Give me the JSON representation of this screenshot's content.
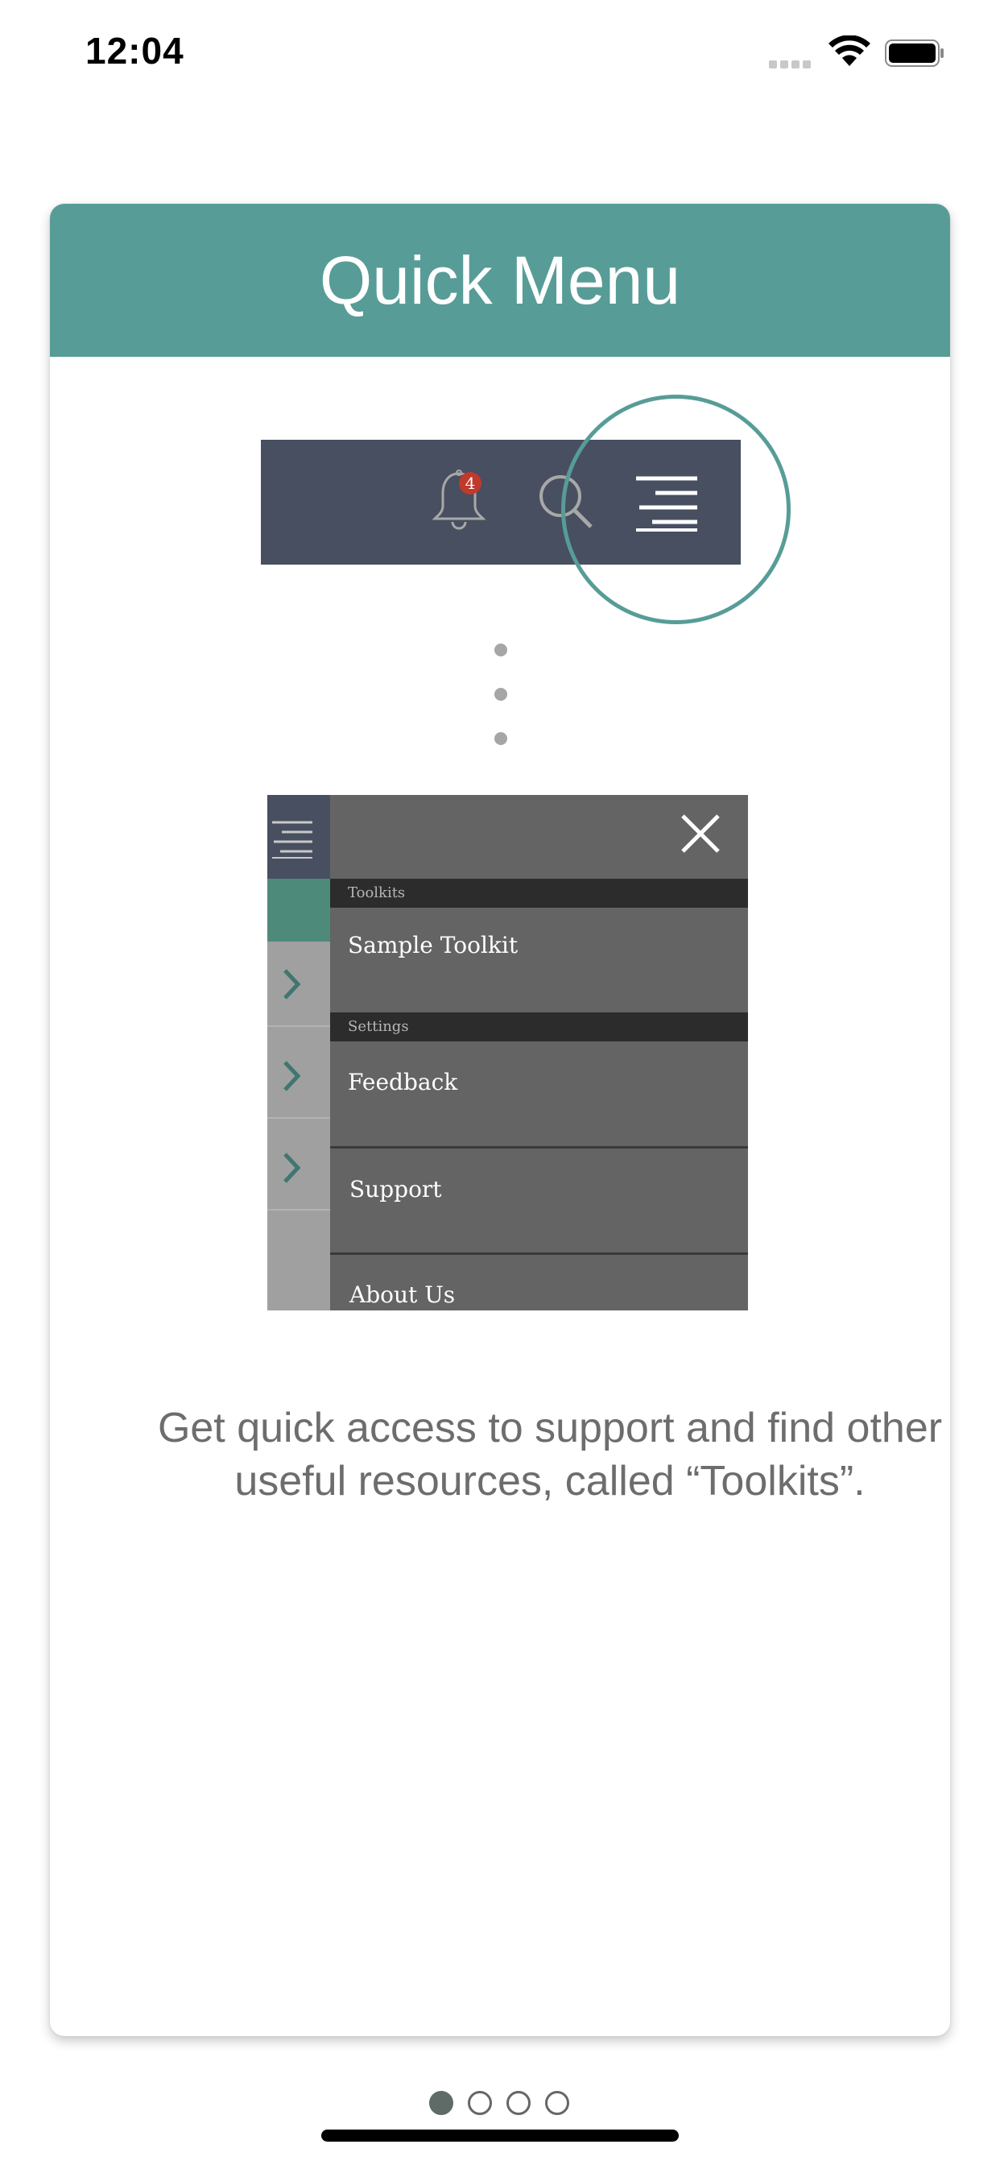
{
  "status_bar": {
    "time": "12:04"
  },
  "card": {
    "title": "Quick Menu",
    "accent_color": "#579c97",
    "illustration_top": {
      "notification_count": "4",
      "icons": [
        "bell-icon",
        "search-icon",
        "menu-icon"
      ]
    },
    "illustration_menu": {
      "sections": [
        {
          "header": "Toolkits",
          "items": [
            "Sample Toolkit"
          ]
        },
        {
          "header": "Settings",
          "items": [
            "Feedback",
            "Support",
            "About Us"
          ]
        }
      ]
    },
    "description_line1": "Get quick access to support and find other",
    "description_line2": "useful resources, called “Toolkits”."
  },
  "pager": {
    "pages": 4,
    "current": 1
  }
}
